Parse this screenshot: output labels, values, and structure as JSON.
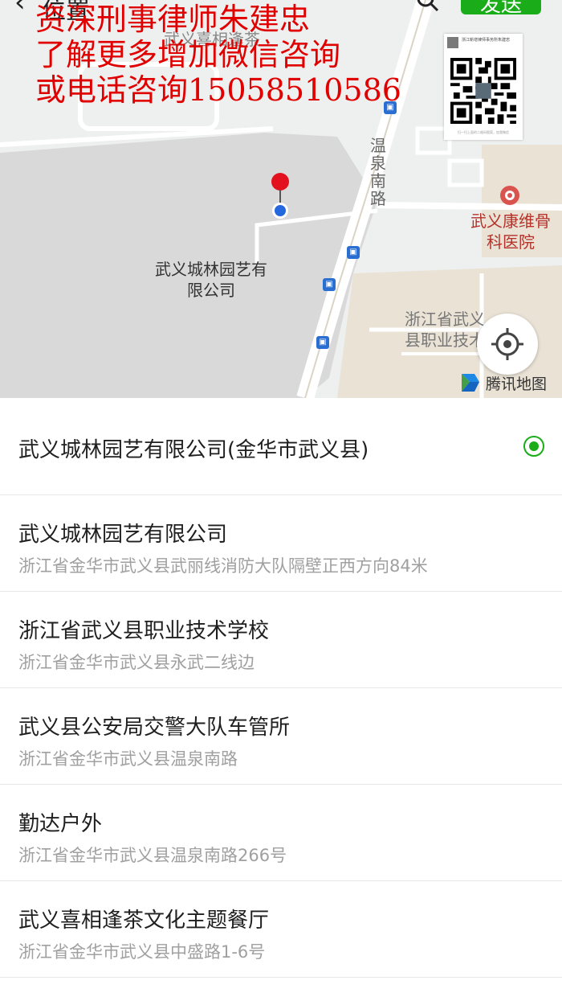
{
  "header": {
    "title_partial": "位置",
    "send_label": "发送"
  },
  "overlay_text": [
    "资深刑事律师朱建忠",
    "了解更多增加微信咨询",
    "或电话咨询15058510586"
  ],
  "qr_card": {
    "name": "浙江新增律师事务所朱建忠",
    "foot": "扫一扫上面的二维码图案，加我微信"
  },
  "map": {
    "labels": {
      "company": "武义城林园艺有限公司",
      "hospital": "武义康维骨科医院",
      "school": "浙江省武义县职业技术",
      "teahouse": "武义喜相逢茶"
    },
    "road": "温泉南路",
    "provider": "腾讯地图",
    "accent": "#1aad19"
  },
  "results": [
    {
      "name": "武义城林园艺有限公司(金华市武义县)",
      "selected": true
    },
    {
      "name": "武义城林园艺有限公司",
      "address": "浙江省金华市武义县武丽线消防大队隔壁正西方向84米"
    },
    {
      "name": "浙江省武义县职业技术学校",
      "address": "浙江省金华市武义县永武二线边"
    },
    {
      "name": "武义县公安局交警大队车管所",
      "address": "浙江省金华市武义县温泉南路"
    },
    {
      "name": "勤达户外",
      "address": "浙江省金华市武义县温泉南路266号"
    },
    {
      "name": "武义喜相逢茶文化主题餐厅",
      "address": "浙江省金华市武义县中盛路1-6号"
    }
  ]
}
